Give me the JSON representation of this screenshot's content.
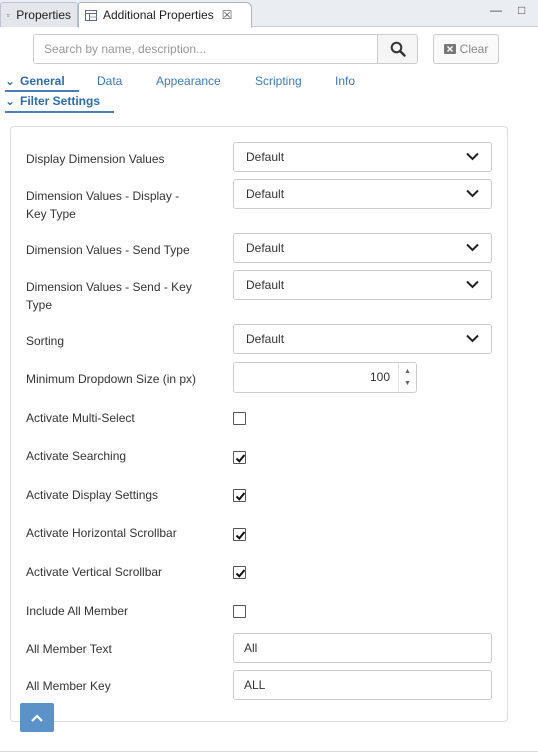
{
  "view_tabs": [
    {
      "label": "Properties",
      "icon": "properties-icon",
      "active": false
    },
    {
      "label": "Additional Properties",
      "icon": "properties-icon",
      "active": true,
      "close": "☒"
    }
  ],
  "window_controls": {
    "minimize": "—",
    "maximize": "□"
  },
  "search": {
    "placeholder": "Search by name, description...",
    "value": "",
    "button_icon": "search-icon"
  },
  "clear_button": {
    "label": "Clear",
    "icon": "clear-icon"
  },
  "nav_tabs": [
    {
      "label": "General",
      "selected": true
    },
    {
      "label": "Data",
      "selected": false
    },
    {
      "label": "Appearance",
      "selected": false
    },
    {
      "label": "Scripting",
      "selected": false
    },
    {
      "label": "Info",
      "selected": false
    }
  ],
  "section_title": "Filter Settings",
  "fields": {
    "display_dimension_values": {
      "label": "Display Dimension Values",
      "value": "Default"
    },
    "dimension_values_display_key_type": {
      "label": "Dimension Values - Display - Key Type",
      "value": "Default"
    },
    "dimension_values_send_type": {
      "label": "Dimension Values - Send Type",
      "value": "Default"
    },
    "dimension_values_send_key_type": {
      "label": "Dimension Values - Send - Key Type",
      "value": "Default"
    },
    "sorting": {
      "label": "Sorting",
      "value": "Default"
    },
    "minimum_dropdown_size": {
      "label": "Minimum Dropdown Size (in px)",
      "value": "100"
    },
    "activate_multi_select": {
      "label": "Activate Multi-Select",
      "checked": false
    },
    "activate_searching": {
      "label": "Activate Searching",
      "checked": true
    },
    "activate_display_settings": {
      "label": "Activate Display Settings",
      "checked": true
    },
    "activate_horizontal_scrollbar": {
      "label": "Activate Horizontal Scrollbar",
      "checked": true
    },
    "activate_vertical_scrollbar": {
      "label": "Activate Vertical Scrollbar",
      "checked": true
    },
    "include_all_member": {
      "label": "Include All Member",
      "checked": false
    },
    "all_member_text": {
      "label": "All Member Text",
      "value": "All"
    },
    "all_member_key": {
      "label": "All Member Key",
      "value": "ALL"
    }
  },
  "colors": {
    "accent": "#2b6cb0",
    "scroll_top_button": "#5b93c9"
  }
}
